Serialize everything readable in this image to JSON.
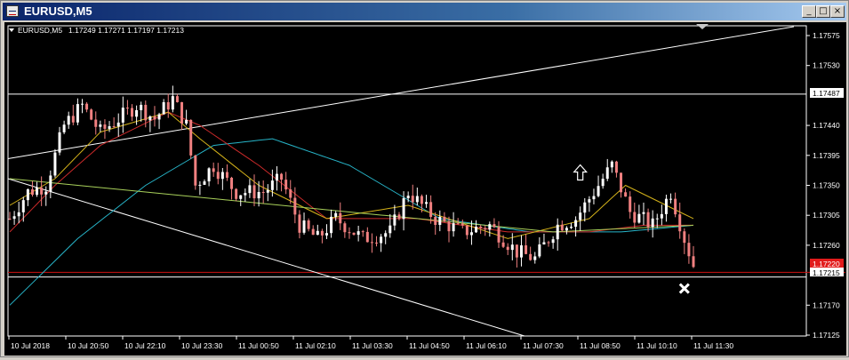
{
  "window": {
    "title": "EURUSD,M5",
    "minimize_glyph": "_",
    "maximize_glyph": "□",
    "close_glyph": "×"
  },
  "chart_info": {
    "symbol_label": "EURUSD,M5",
    "ohlc": "1.17249 1.17271 1.17197 1.17213"
  },
  "price_axis": {
    "ticks": [
      "1.17575",
      "1.17530",
      "1.17440",
      "1.17395",
      "1.17350",
      "1.17305",
      "1.17260",
      "1.17170",
      "1.17125"
    ],
    "hline_label": "1.17487",
    "bid_label": "1.17220",
    "ask_label": "1.17215"
  },
  "time_axis": {
    "labels": [
      "10 Jul 2018",
      "10 Jul 20:50",
      "10 Jul 22:10",
      "10 Jul 23:30",
      "11 Jul 00:50",
      "11 Jul 02:10",
      "11 Jul 03:30",
      "11 Jul 04:50",
      "11 Jul 06:10",
      "11 Jul 07:30",
      "11 Jul 08:50",
      "11 Jul 10:10",
      "11 Jul 11:30"
    ]
  },
  "colors": {
    "background": "#000000",
    "foreground": "#ffffff",
    "bull_candle": "#ffffff",
    "bear_candle": "#f08080",
    "ma_slow": "#27b5c9",
    "ma_mid": "#cc2a2a",
    "ma_fast": "#d4b21a",
    "ma_long": "#a8d05a",
    "bid_line": "#cc1111",
    "bid_label_bg": "#e21b1b"
  },
  "chart_data": {
    "type": "candlestick",
    "symbol": "EURUSD",
    "timeframe": "M5",
    "current_ohlc": {
      "open": 1.17249,
      "high": 1.17271,
      "low": 1.17197,
      "close": 1.17213
    },
    "ylim": [
      1.171,
      1.176
    ],
    "horizontal_levels": [
      1.17487,
      1.1722,
      1.17215
    ],
    "trendlines": [
      {
        "from": [
          "10 Jul 2018",
          1.1739
        ],
        "to": [
          "11 Jul 11:30",
          1.1759
        ]
      },
      {
        "from": [
          "10 Jul 2018",
          1.1736
        ],
        "to": [
          "11 Jul 07:30",
          1.17125
        ]
      }
    ],
    "price_path": [
      {
        "t": 0,
        "p": 1.173
      },
      {
        "t": 4,
        "p": 1.1734
      },
      {
        "t": 8,
        "p": 1.1735
      },
      {
        "t": 12,
        "p": 1.1744
      },
      {
        "t": 16,
        "p": 1.1747
      },
      {
        "t": 20,
        "p": 1.1743
      },
      {
        "t": 24,
        "p": 1.1745
      },
      {
        "t": 28,
        "p": 1.1747
      },
      {
        "t": 32,
        "p": 1.1745
      },
      {
        "t": 36,
        "p": 1.1748
      },
      {
        "t": 39,
        "p": 1.1744
      },
      {
        "t": 41,
        "p": 1.1735
      },
      {
        "t": 45,
        "p": 1.1738
      },
      {
        "t": 50,
        "p": 1.1734
      },
      {
        "t": 56,
        "p": 1.1734
      },
      {
        "t": 60,
        "p": 1.1736
      },
      {
        "t": 64,
        "p": 1.1729
      },
      {
        "t": 68,
        "p": 1.1727
      },
      {
        "t": 72,
        "p": 1.173
      },
      {
        "t": 78,
        "p": 1.1727
      },
      {
        "t": 84,
        "p": 1.1728
      },
      {
        "t": 88,
        "p": 1.1734
      },
      {
        "t": 94,
        "p": 1.173
      },
      {
        "t": 100,
        "p": 1.1728
      },
      {
        "t": 106,
        "p": 1.1729
      },
      {
        "t": 112,
        "p": 1.1725
      },
      {
        "t": 116,
        "p": 1.1724
      },
      {
        "t": 121,
        "p": 1.1729
      },
      {
        "t": 125,
        "p": 1.173
      },
      {
        "t": 129,
        "p": 1.1734
      },
      {
        "t": 133,
        "p": 1.1738
      },
      {
        "t": 137,
        "p": 1.1731
      },
      {
        "t": 142,
        "p": 1.1729
      },
      {
        "t": 146,
        "p": 1.1734
      },
      {
        "t": 149,
        "p": 1.1727
      },
      {
        "t": 151,
        "p": 1.1723
      }
    ],
    "moving_averages": [
      {
        "color": "ma_slow",
        "points": [
          {
            "t": 0,
            "p": 1.1717
          },
          {
            "t": 15,
            "p": 1.1727
          },
          {
            "t": 30,
            "p": 1.1735
          },
          {
            "t": 45,
            "p": 1.1741
          },
          {
            "t": 58,
            "p": 1.1742
          },
          {
            "t": 75,
            "p": 1.1738
          },
          {
            "t": 95,
            "p": 1.173
          },
          {
            "t": 115,
            "p": 1.1728
          },
          {
            "t": 135,
            "p": 1.1728
          },
          {
            "t": 151,
            "p": 1.1729
          }
        ]
      },
      {
        "color": "ma_mid",
        "points": [
          {
            "t": 0,
            "p": 1.1728
          },
          {
            "t": 10,
            "p": 1.1735
          },
          {
            "t": 20,
            "p": 1.1741
          },
          {
            "t": 35,
            "p": 1.1746
          },
          {
            "t": 42,
            "p": 1.1744
          },
          {
            "t": 55,
            "p": 1.1738
          },
          {
            "t": 70,
            "p": 1.173
          },
          {
            "t": 90,
            "p": 1.173
          },
          {
            "t": 110,
            "p": 1.1728
          },
          {
            "t": 128,
            "p": 1.1728
          },
          {
            "t": 140,
            "p": 1.1729
          },
          {
            "t": 151,
            "p": 1.1729
          }
        ]
      },
      {
        "color": "ma_fast",
        "points": [
          {
            "t": 0,
            "p": 1.1732
          },
          {
            "t": 10,
            "p": 1.1736
          },
          {
            "t": 20,
            "p": 1.1743
          },
          {
            "t": 35,
            "p": 1.1746
          },
          {
            "t": 42,
            "p": 1.1742
          },
          {
            "t": 55,
            "p": 1.1735
          },
          {
            "t": 70,
            "p": 1.173
          },
          {
            "t": 88,
            "p": 1.1732
          },
          {
            "t": 110,
            "p": 1.1727
          },
          {
            "t": 128,
            "p": 1.173
          },
          {
            "t": 136,
            "p": 1.1735
          },
          {
            "t": 145,
            "p": 1.1732
          },
          {
            "t": 151,
            "p": 1.173
          }
        ]
      },
      {
        "color": "ma_long",
        "points": [
          {
            "t": 0,
            "p": 1.1736
          },
          {
            "t": 30,
            "p": 1.1734
          },
          {
            "t": 60,
            "p": 1.1732
          },
          {
            "t": 90,
            "p": 1.173
          },
          {
            "t": 120,
            "p": 1.1728
          },
          {
            "t": 151,
            "p": 1.1729
          }
        ]
      }
    ],
    "markers": [
      {
        "type": "buy-arrow",
        "t": 126,
        "p": 1.1737
      },
      {
        "type": "sell-cross",
        "t": 149,
        "p": 1.17195
      }
    ]
  }
}
